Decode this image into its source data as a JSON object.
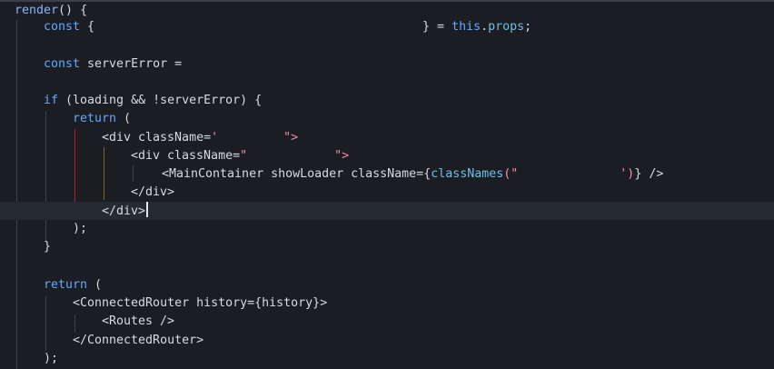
{
  "editor": {
    "lines": {
      "l1": {
        "t1": "render",
        "t2": "() {"
      },
      "l2": {
        "t1": "const",
        "t2": " {",
        "t3": "} = ",
        "t4": "this",
        "t5": ".",
        "t6": "props",
        "t7": ";"
      },
      "l4": {
        "t1": "const",
        "t2": " serverError ="
      },
      "l6": {
        "t1": "if",
        "t2": " (loading && !serverError) {"
      },
      "l7": {
        "t1": "return",
        "t2": " ("
      },
      "l8": {
        "t1": "<div className=",
        "t2": "'",
        "t3": "\">"
      },
      "l9": {
        "t1": "<div className=",
        "t2": "\"",
        "t3": "\">"
      },
      "l10": {
        "t1": "<MainContainer showLoader className=",
        "t2": "{",
        "t3": "classNames",
        "t4": "(\"",
        "t5": "')",
        "t6": "} />"
      },
      "l11": {
        "t1": "</div>"
      },
      "l12": {
        "t1": "</div>"
      },
      "l13": {
        "t1": ");"
      },
      "l14": {
        "t1": "}"
      },
      "l16": {
        "t1": "return",
        "t2": " ("
      },
      "l17": {
        "t1": "<ConnectedRouter history=",
        "t2": "{history}",
        "t3": ">"
      },
      "l18": {
        "t1": "<Routes />"
      },
      "l19": {
        "t1": "</ConnectedRouter>"
      },
      "l20": {
        "t1": ");"
      }
    }
  }
}
